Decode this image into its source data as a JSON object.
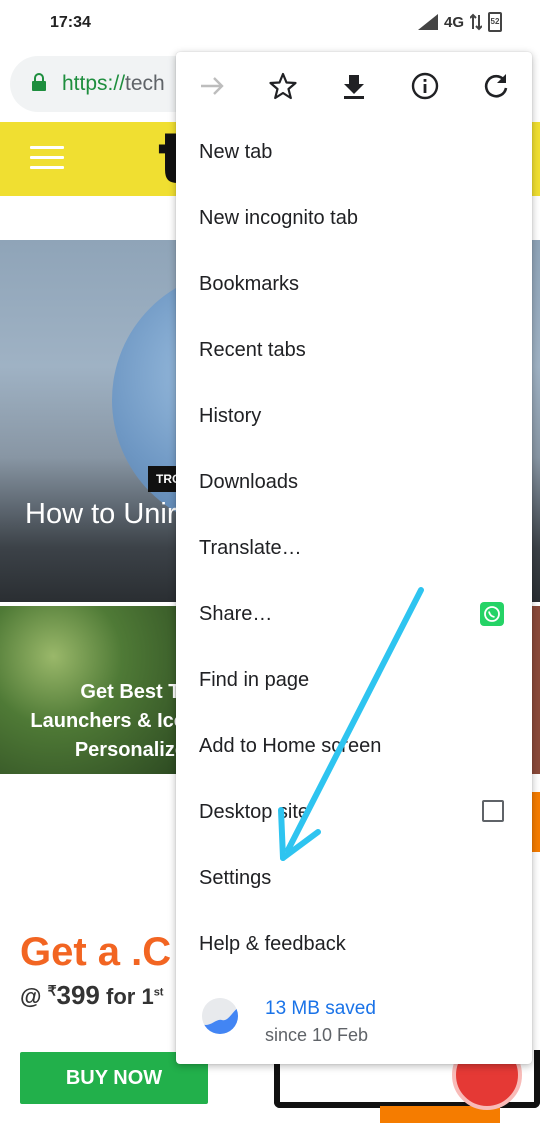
{
  "status_bar": {
    "time": "17:34",
    "network": "4G",
    "battery": "52"
  },
  "url_bar": {
    "scheme": "https://",
    "host_visible": "tech"
  },
  "site": {
    "logo_char": "t",
    "hero": {
      "tag": "TRO",
      "title": "How to Unir"
    },
    "thumb_left": {
      "title_lines": [
        "Get Best Tl",
        "Launchers & Ico",
        "Personalize"
      ]
    },
    "ad": {
      "headline": "Get a .C",
      "price_prefix": "@ ",
      "currency": "₹",
      "price": "399",
      "price_suffix": " for 1",
      "price_sup": "st",
      "cta": "BUY NOW"
    }
  },
  "menu": {
    "toolbar": [
      "forward-icon",
      "bookmark-star-icon",
      "download-icon",
      "page-info-icon",
      "reload-icon"
    ],
    "items": [
      {
        "label": "New tab"
      },
      {
        "label": "New incognito tab"
      },
      {
        "label": "Bookmarks"
      },
      {
        "label": "Recent tabs"
      },
      {
        "label": "History"
      },
      {
        "label": "Downloads"
      },
      {
        "label": "Translate…"
      },
      {
        "label": "Share…"
      },
      {
        "label": "Find in page"
      },
      {
        "label": "Add to Home screen"
      },
      {
        "label": "Desktop site"
      },
      {
        "label": "Settings"
      },
      {
        "label": "Help & feedback"
      }
    ],
    "data_saver": {
      "main": "13 MB saved",
      "sub": "since 10 Feb"
    }
  },
  "colors": {
    "accent_blue": "#1a73e8",
    "site_yellow": "#f0df31",
    "annotation_arrow": "#2ec4f0",
    "ad_orange": "#f26522",
    "buy_green": "#22b04b"
  }
}
